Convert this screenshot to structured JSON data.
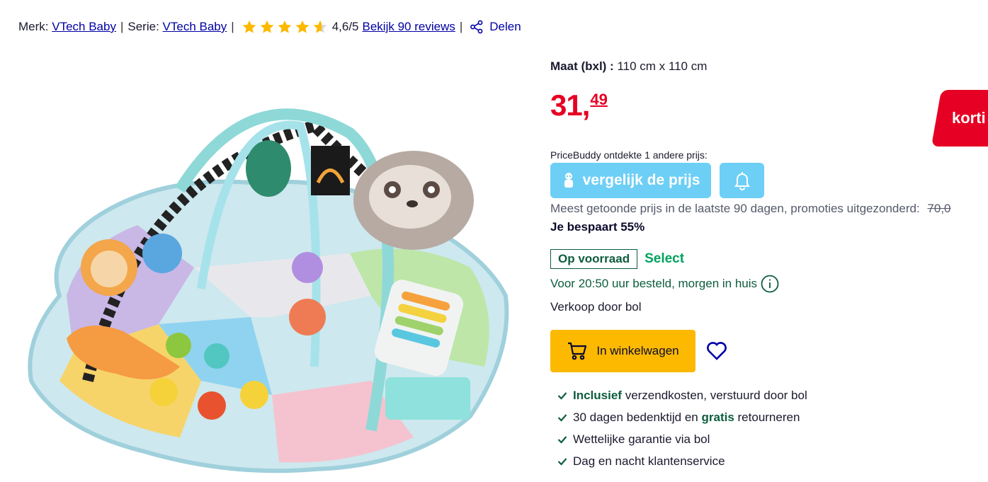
{
  "meta": {
    "brand_label": "Merk:",
    "brand_name": "VTech Baby",
    "series_label": "Serie:",
    "series_name": "VTech Baby",
    "rating": 4.6,
    "rating_text": "4,6/5",
    "reviews_link": "Bekijk 90 reviews",
    "share_label": "Delen",
    "separator": "|"
  },
  "product": {
    "spec_label": "Maat (bxl) :",
    "spec_value": "110 cm x 110 cm",
    "price_whole": "31,",
    "price_cents": "49",
    "promo_badge": "korti",
    "pricebuddy_text": "PriceBuddy ontdekte 1 andere prijs:",
    "compare_button": "vergelijk de prijs",
    "price_history_text": "Meest getoonde prijs in de laatste 90 dagen, promoties uitgezonderd:",
    "old_price": "70,0",
    "savings": "Je bespaart 55%",
    "stock_status": "Op voorraad",
    "select_label": "Select",
    "delivery_text": "Voor 20:50 uur besteld, morgen in huis",
    "seller_text": "Verkoop door bol",
    "cart_button": "In winkelwagen"
  },
  "usps": [
    {
      "highlight": "Inclusief",
      "rest": " verzendkosten, verstuurd door bol"
    },
    {
      "pre": "30 dagen bedenktijd en ",
      "highlight": "gratis",
      "rest": " retourneren"
    },
    {
      "rest": "Wettelijke garantie via bol"
    },
    {
      "rest": "Dag en nacht klantenservice"
    }
  ],
  "colors": {
    "price_red": "#e60023",
    "link_blue": "#0000a4",
    "star_yellow": "#fcb900",
    "pricebuddy_blue": "#6dcff6",
    "stock_green": "#0d5d3e",
    "select_green": "#01a25e",
    "cart_yellow": "#fcb900"
  },
  "icons": [
    "star-icon",
    "share-icon",
    "pricebuddy-icon",
    "bell-icon",
    "info-icon",
    "cart-icon",
    "heart-icon",
    "check-icon"
  ]
}
